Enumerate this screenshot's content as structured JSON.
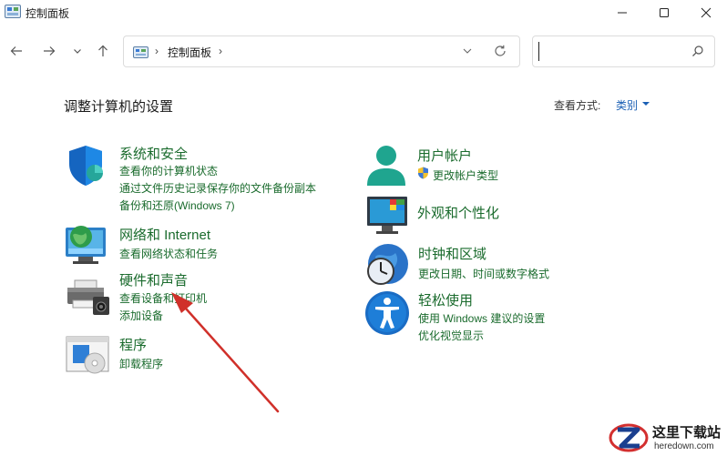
{
  "window": {
    "title": "控制面板"
  },
  "address": {
    "crumb": "控制面板",
    "separator": "›"
  },
  "search": {
    "placeholder": ""
  },
  "header": {
    "title": "调整计算机的设置",
    "view_label": "查看方式:",
    "view_value": "类别"
  },
  "categories": {
    "system_security": {
      "title": "系统和安全",
      "links": [
        "查看你的计算机状态",
        "通过文件历史记录保存你的文件备份副本",
        "备份和还原(Windows 7)"
      ]
    },
    "network": {
      "title": "网络和 Internet",
      "links": [
        "查看网络状态和任务"
      ]
    },
    "hardware": {
      "title": "硬件和声音",
      "links": [
        "查看设备和打印机",
        "添加设备"
      ]
    },
    "programs": {
      "title": "程序",
      "links": [
        "卸载程序"
      ]
    },
    "user_accounts": {
      "title": "用户帐户",
      "links": [
        "更改帐户类型"
      ]
    },
    "appearance": {
      "title": "外观和个性化",
      "links": []
    },
    "clock_region": {
      "title": "时钟和区域",
      "links": [
        "更改日期、时间或数字格式"
      ]
    },
    "ease_of_access": {
      "title": "轻松使用",
      "links": [
        "使用 Windows 建议的设置",
        "优化视觉显示"
      ]
    }
  },
  "watermark": {
    "main": "这里下载站",
    "sub": "heredown.com"
  },
  "colors": {
    "link_green": "#1a6b2d",
    "accent_blue": "#1a5fb4",
    "arrow_red": "#d0302a"
  }
}
